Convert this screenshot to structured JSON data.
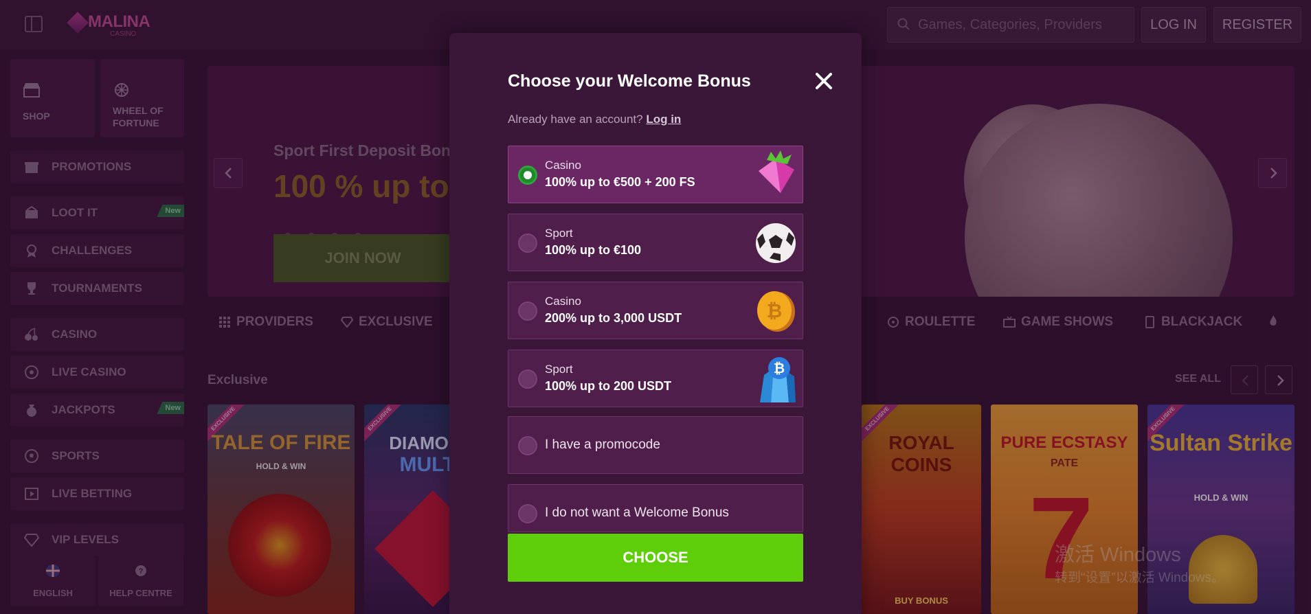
{
  "header": {
    "logo_text": "MALINA",
    "logo_sub": "CASINO",
    "search_placeholder": "Games, Categories, Providers",
    "login_label": "LOG IN",
    "register_label": "REGISTER"
  },
  "sidebar": {
    "shop": "SHOP",
    "wheel_line1": "WHEEL OF",
    "wheel_line2": "FORTUNE",
    "items": [
      {
        "label": "PROMOTIONS"
      },
      {
        "label": "LOOT IT",
        "badge": "New"
      },
      {
        "label": "CHALLENGES"
      },
      {
        "label": "TOURNAMENTS"
      },
      {
        "label": "CASINO"
      },
      {
        "label": "LIVE CASINO"
      },
      {
        "label": "JACKPOTS",
        "badge": "New"
      },
      {
        "label": "SPORTS"
      },
      {
        "label": "LIVE BETTING"
      },
      {
        "label": "VIP LEVELS"
      }
    ],
    "language": "ENGLISH",
    "help": "HELP CENTRE"
  },
  "hero": {
    "subtitle": "Sport First Deposit Bon",
    "title": "100 % up to",
    "cta": "JOIN NOW"
  },
  "categories": [
    "PROVIDERS",
    "EXCLUSIVE",
    "ROULETTE",
    "GAME SHOWS",
    "BLACKJACK"
  ],
  "games_section": {
    "title": "Exclusive",
    "see_all": "SEE ALL",
    "badge": "EXCLUSIVE",
    "games": [
      {
        "title": "TALE OF FIRE",
        "sub": "HOLD & WIN"
      },
      {
        "title": "DIAMONDS",
        "sub": "MULTIB"
      },
      {
        "title": "ROYAL COINS",
        "sub": "BUY BONUS"
      },
      {
        "title": "PURE ECSTASY",
        "sub": "PATE"
      },
      {
        "title": "Sultan Strike",
        "sub": "HOLD & WIN"
      }
    ]
  },
  "watermark": {
    "line1": "激活 Windows",
    "line2": "转到“设置”以激活 Windows。"
  },
  "modal": {
    "title": "Choose your Welcome Bonus",
    "account_prompt": "Already have an account?",
    "login_link": "Log in",
    "options": [
      {
        "kind": "Casino",
        "offer": "100% up to €500 + 200 FS",
        "selected": true,
        "art": "gem-icon"
      },
      {
        "kind": "Sport",
        "offer": "100% up to €100",
        "selected": false,
        "art": "football-icon"
      },
      {
        "kind": "Casino",
        "offer": "200% up to 3,000 USDT",
        "selected": false,
        "art": "bitcoin-coin-icon"
      },
      {
        "kind": "Sport",
        "offer": "100% up to 200 USDT",
        "selected": false,
        "art": "bitcoin-crystal-icon"
      },
      {
        "label": "I have a promocode",
        "selected": false
      },
      {
        "label": "I do not want a Welcome Bonus",
        "selected": false
      }
    ],
    "choose_label": "CHOOSE"
  },
  "colors": {
    "background": "#3a1637",
    "modal": "#3a1738",
    "option": "#4f1e4b",
    "option_selected": "#6a2763",
    "choose_button": "#5fce0a",
    "radio_selected": "#1e8a2a"
  }
}
